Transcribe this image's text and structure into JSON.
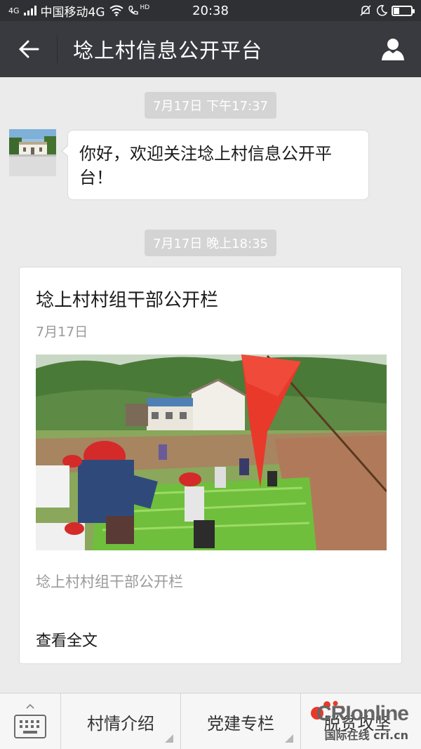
{
  "status_bar": {
    "network": "4G",
    "carrier": "中国移动4G",
    "hd_label": "HD",
    "time": "20:38"
  },
  "nav": {
    "title": "埝上村信息公开平台",
    "back_icon": "arrow-left-icon",
    "profile_icon": "person-icon"
  },
  "chat": {
    "timestamp_1": "7月17日 下午17:37",
    "welcome_message": "你好，欢迎关注埝上村信息公开平台！",
    "timestamp_2": "7月17日 晚上18:35",
    "article": {
      "title": "埝上村村组干部公开栏",
      "date": "7月17日",
      "summary": "埝上村村组干部公开栏",
      "read_more": "查看全文"
    }
  },
  "bottom_menu": {
    "keyboard_icon": "keyboard-icon",
    "items": [
      {
        "label": "村情介绍"
      },
      {
        "label": "党建专栏"
      },
      {
        "label": "脱贫攻坚"
      }
    ]
  },
  "watermark": {
    "brand": "CRIonline",
    "sub": "国际在线 cri.cn"
  },
  "colors": {
    "status_bar_bg": "#2f3033",
    "nav_bg": "#393a3f",
    "chat_bg": "#ebebeb",
    "flag_red": "#e8392a"
  }
}
